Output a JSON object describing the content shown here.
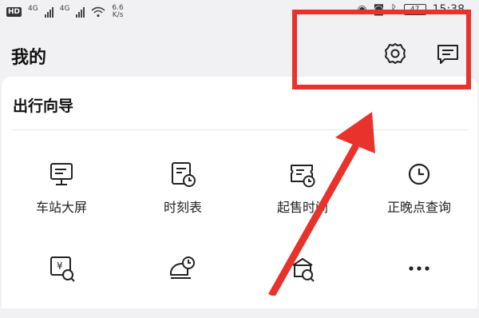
{
  "status_bar": {
    "left_badge": "HD",
    "net1": "4G",
    "net2": "4G",
    "speed_value": "6.6",
    "speed_unit": "K/s",
    "battery": "47",
    "time": "15:38"
  },
  "header": {
    "title": "我的",
    "settings_icon": "settings-gear-icon",
    "message_icon": "message-icon"
  },
  "guide": {
    "title": "出行向导",
    "items": [
      {
        "label": "车站大屏",
        "icon": "station-screen-icon"
      },
      {
        "label": "时刻表",
        "icon": "timetable-icon"
      },
      {
        "label": "起售时间",
        "icon": "ticket-sale-time-icon"
      },
      {
        "label": "正晚点查询",
        "icon": "clock-icon"
      },
      {
        "label": "",
        "icon": "ticket-price-search-icon"
      },
      {
        "label": "",
        "icon": "train-time-icon"
      },
      {
        "label": "",
        "icon": "station-search-icon"
      },
      {
        "label": "",
        "icon": "more-icon"
      }
    ]
  },
  "annotation": {
    "color": "#e8322b"
  }
}
